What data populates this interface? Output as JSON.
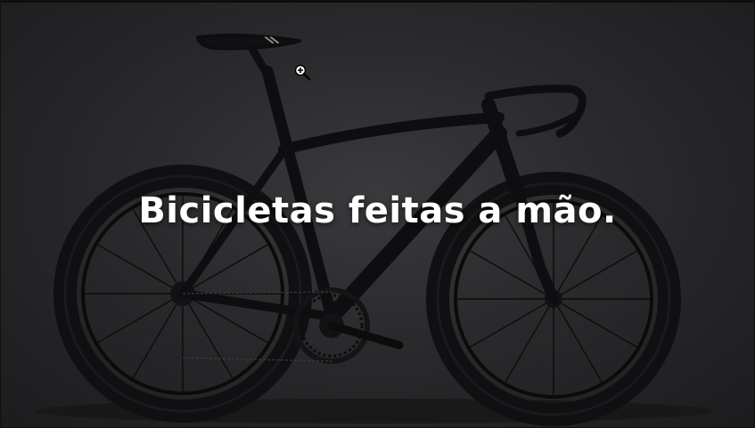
{
  "hero": {
    "headline": "Bicicletas feitas a mão.",
    "image_subject": "black road bicycle on dark background",
    "cursor_icon": "zoom-in-cursor-icon"
  },
  "colors": {
    "background": "#2a2a2c",
    "headline_text": "#ffffff",
    "bike": "#0e0e10"
  }
}
